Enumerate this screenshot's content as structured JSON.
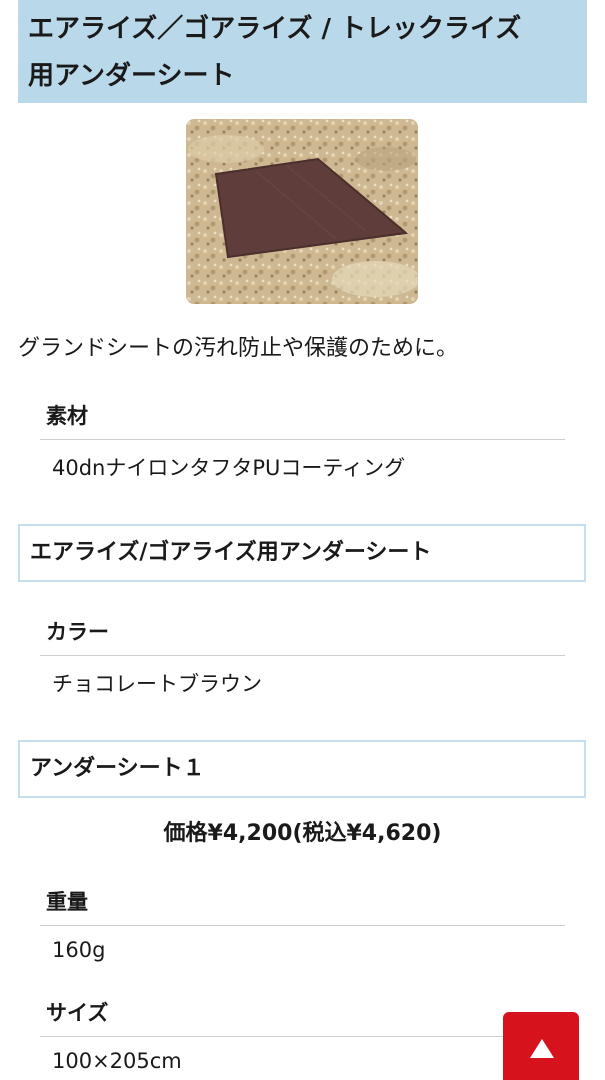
{
  "header": {
    "title_line1": "エアライズ／ゴアライズ / トレックライズ",
    "title_line2": "用アンダーシート"
  },
  "product_image": {
    "alt": "アンダーシート",
    "sheet_color": "#5e3d3a"
  },
  "description": "グランドシートの汚れ防止や保護のために。",
  "material": {
    "label": "素材",
    "value": "40dnナイロンタフタPUコーティング"
  },
  "model_heading": "エアライズ/ゴアライズ用アンダーシート",
  "color": {
    "label": "カラー",
    "value": "チョコレートブラウン"
  },
  "variant_heading": "アンダーシート１",
  "price": "価格¥4,200(税込¥4,620)",
  "weight": {
    "label": "重量",
    "value": "160g"
  },
  "size": {
    "label": "サイズ",
    "value": "100×205cm"
  },
  "colors": {
    "header_bg": "#b9d9eb",
    "box_border": "#c5dfec",
    "top_button": "#d6131d"
  },
  "icons": {
    "top_button": "up-arrow-icon"
  }
}
